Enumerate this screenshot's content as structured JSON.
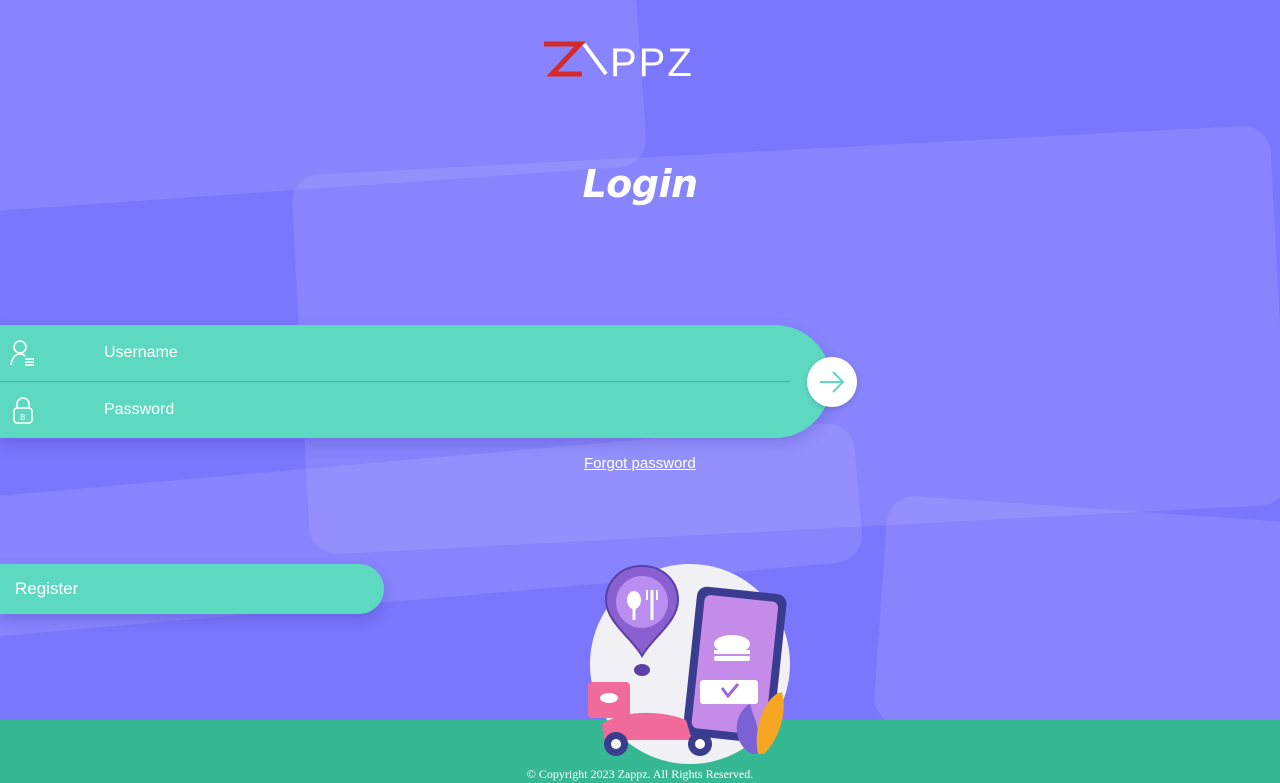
{
  "brand": {
    "name": "ZAPPZ",
    "logo_colors": {
      "accent": "#d62a2a",
      "main": "#ffffff"
    }
  },
  "login": {
    "title": "Login",
    "username": {
      "placeholder": "Username",
      "value": "",
      "icon": "user-icon"
    },
    "password": {
      "placeholder": "Password",
      "value": "",
      "icon": "lock-icon"
    },
    "submit_icon": "arrow-right-icon",
    "forgot_label": "Forgot password"
  },
  "register": {
    "label": "Register"
  },
  "footer": {
    "copyright": "© Copyright 2023 Zappz. All Rights Reserved."
  },
  "illustration": {
    "name": "food-delivery-illustration"
  },
  "colors": {
    "background": "#7a76fd",
    "panel": "#5dd9c2",
    "footer": "#36b894",
    "text": "#ffffff"
  }
}
